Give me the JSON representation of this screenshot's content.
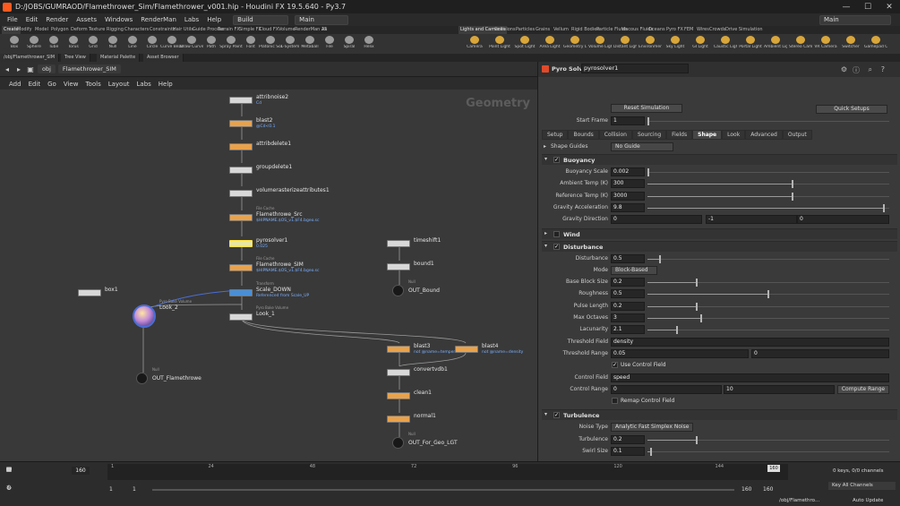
{
  "window": {
    "title": "D:/JOBS/GUMRAOD/Flamethrower_Sim/Flamethrower_v001.hip - Houdini FX 19.5.640 - Py3.7",
    "minimize": "—",
    "maximize": "☐",
    "close": "✕"
  },
  "menu": [
    "File",
    "Edit",
    "Render",
    "Assets",
    "Windows",
    "RenderMan",
    "Labs",
    "Help"
  ],
  "desktop": {
    "build": "Build",
    "main": "Main",
    "main_right": "Main"
  },
  "shelf_tabs_left": [
    "Create",
    "Modify",
    "Model",
    "Polygon",
    "Deform",
    "Texture",
    "Rigging",
    "Characters",
    "Constraints",
    "Hair Utils",
    "Guide Process",
    "Terrain FX",
    "Simple FX",
    "Cloud FX",
    "Volume",
    "RenderMan 25",
    "Ak"
  ],
  "shelf_tabs_right": [
    "Lights and Cameras",
    "Collisions",
    "Particles",
    "Grains",
    "Vellum",
    "Rigid Bodies",
    "Particle Fluids",
    "Viscous Fluids",
    "Oceans",
    "Pyro FX",
    "FEM",
    "Wires",
    "Crowds",
    "Drive Simulation"
  ],
  "shelf_tools_left": [
    "Box",
    "Sphere",
    "Tube",
    "Torus",
    "Grid",
    "Null",
    "Line",
    "Circle",
    "Curve Bezier",
    "Draw Curve",
    "Path",
    "Spray Paint",
    "Font",
    "Platonic Solids",
    "L-System",
    "Metaball",
    "File",
    "Spiral",
    "Helix"
  ],
  "shelf_tools_right": [
    "Camera",
    "Point Light",
    "Spot Light",
    "Area Light",
    "Geometry Light",
    "Volume Light",
    "Distant Light",
    "Environment Light",
    "Sky Light",
    "GI Light",
    "Caustic Light",
    "Portal Light",
    "Ambient Light",
    "Stereo Camera",
    "VR Camera",
    "Switcher",
    "Gamepad Camera"
  ],
  "pane_tabs": [
    "/obj/Flamethrower_SIM",
    "Tree View",
    "Material Palette",
    "Asset Browser"
  ],
  "path": {
    "root": "obj",
    "current": "Flamethrower_SIM"
  },
  "network_menu": [
    "Add",
    "Edit",
    "Go",
    "View",
    "Tools",
    "Layout",
    "Labs",
    "Help"
  ],
  "network_watermark": "Geometry",
  "nodes": [
    {
      "name": "attribnoise2",
      "sub": "Cd",
      "tag": ""
    },
    {
      "name": "blast2",
      "sub": "@Cd<0.1",
      "tag": ""
    },
    {
      "name": "attribdelete1",
      "sub": "",
      "tag": ""
    },
    {
      "name": "groupdelete1",
      "sub": "",
      "tag": ""
    },
    {
      "name": "volumerasterizeattributes1",
      "sub": "",
      "tag": ""
    },
    {
      "name": "Flamethrowe_Src",
      "sub": "$HIPNAME.$OS_v1.$F4.bgeo.sc",
      "tag": "File Cache"
    },
    {
      "name": "pyrosolver1",
      "sub": "0.025",
      "tag": ""
    },
    {
      "name": "Flamethrowe_SIM",
      "sub": "$HIPNAME.$OS_v1.$F4.bgeo.sc",
      "tag": "File Cache"
    },
    {
      "name": "Scale_DOWN",
      "sub": "Referenced from Scale_UP",
      "tag": "Transform"
    },
    {
      "name": "Look_1",
      "sub": "",
      "tag": "Pyro Bake Volume"
    },
    {
      "name": "Look_2",
      "sub": "",
      "tag": "Pyro Bake Volume"
    },
    {
      "name": "box1",
      "sub": "",
      "tag": ""
    },
    {
      "name": "OUT_Flamethrowe",
      "sub": "",
      "tag": "Null"
    },
    {
      "name": "timeshift1",
      "sub": "",
      "tag": ""
    },
    {
      "name": "bound1",
      "sub": "",
      "tag": ""
    },
    {
      "name": "OUT_Bound",
      "sub": "",
      "tag": "Null"
    },
    {
      "name": "blast3",
      "sub": "not @name=temperature",
      "tag": ""
    },
    {
      "name": "blast4",
      "sub": "not @name=density",
      "tag": ""
    },
    {
      "name": "convertvdb1",
      "sub": "",
      "tag": ""
    },
    {
      "name": "clean1",
      "sub": "",
      "tag": ""
    },
    {
      "name": "normal1",
      "sub": "",
      "tag": ""
    },
    {
      "name": "OUT_For_Geo_LGT",
      "sub": "",
      "tag": "Null"
    }
  ],
  "params": {
    "node_type": "Pyro Solver",
    "node_name": "pyrosolver1",
    "reset_label": "Reset Simulation",
    "quick_setups": "Quick Setups",
    "start_frame_label": "Start Frame",
    "start_frame": "1",
    "tabs": [
      "Setup",
      "Bounds",
      "Collision",
      "Sourcing",
      "Fields",
      "Shape",
      "Look",
      "Advanced",
      "Output"
    ],
    "active_tab": "Shape",
    "shape_guides_label": "Shape Guides",
    "shape_guides": "No Guide",
    "buoyancy": {
      "title": "Buoyancy",
      "rows": [
        {
          "label": "Buoyancy Scale",
          "value": "0.002",
          "frac": 0.0
        },
        {
          "label": "Ambient Temp (K)",
          "value": "300",
          "frac": 0.6
        },
        {
          "label": "Reference Temp (K)",
          "value": "3000",
          "frac": 0.6
        },
        {
          "label": "Gravity Acceleration",
          "value": "9.8",
          "frac": 0.98
        }
      ],
      "gravity_label": "Gravity Direction",
      "gravity": [
        "0",
        "-1",
        "0"
      ]
    },
    "wind_title": "Wind",
    "disturbance": {
      "title": "Disturbance",
      "disturbance_label": "Disturbance",
      "disturbance_value": "0.5",
      "mode_label": "Mode",
      "mode": "Block-Based",
      "rows": [
        {
          "label": "Base Block Size",
          "value": "0.2",
          "frac": 0.2
        },
        {
          "label": "Roughness",
          "value": "0.5",
          "frac": 0.5
        },
        {
          "label": "Pulse Length",
          "value": "0.2",
          "frac": 0.2
        },
        {
          "label": "Max Octaves",
          "value": "3",
          "frac": 0.22
        },
        {
          "label": "Lacunarity",
          "value": "2.1",
          "frac": 0.12
        }
      ],
      "threshold_field_label": "Threshold Field",
      "threshold_field": "density",
      "threshold_range_label": "Threshold Range",
      "threshold_range": [
        "0.05",
        "0"
      ],
      "use_control_field": "Use Control Field",
      "control_field_label": "Control Field",
      "control_field": "speed",
      "control_range_label": "Control Range",
      "control_range": [
        "0",
        "10"
      ],
      "compute_range": "Compute Range",
      "remap_control_field": "Remap Control Field"
    },
    "turbulence": {
      "title": "Turbulence",
      "noise_type_label": "Noise Type",
      "noise_type": "Analytic Fast Simplex Noise",
      "rows": [
        {
          "label": "Turbulence",
          "value": "0.2",
          "frac": 0.2
        },
        {
          "label": "Swirl Size",
          "value": "0.1",
          "frac": 0.01
        }
      ]
    }
  },
  "timeline": {
    "ticks": [
      "1",
      "24",
      "48",
      "72",
      "96",
      "120",
      "144",
      "160"
    ],
    "current_frame": "160",
    "frame_display": "160",
    "range_start": "1",
    "range_start2": "1",
    "range_end": "160",
    "range_end2": "160",
    "keys": "0 keys, 0/0 channels",
    "key_all": "Key All Channels",
    "status_path": "/obj/Flamethro...",
    "auto_update": "Auto Update"
  },
  "colors": {
    "accent": "#ff5a1e",
    "node_selected": "#ffe13c",
    "link_blue": "#4a6ed6"
  }
}
